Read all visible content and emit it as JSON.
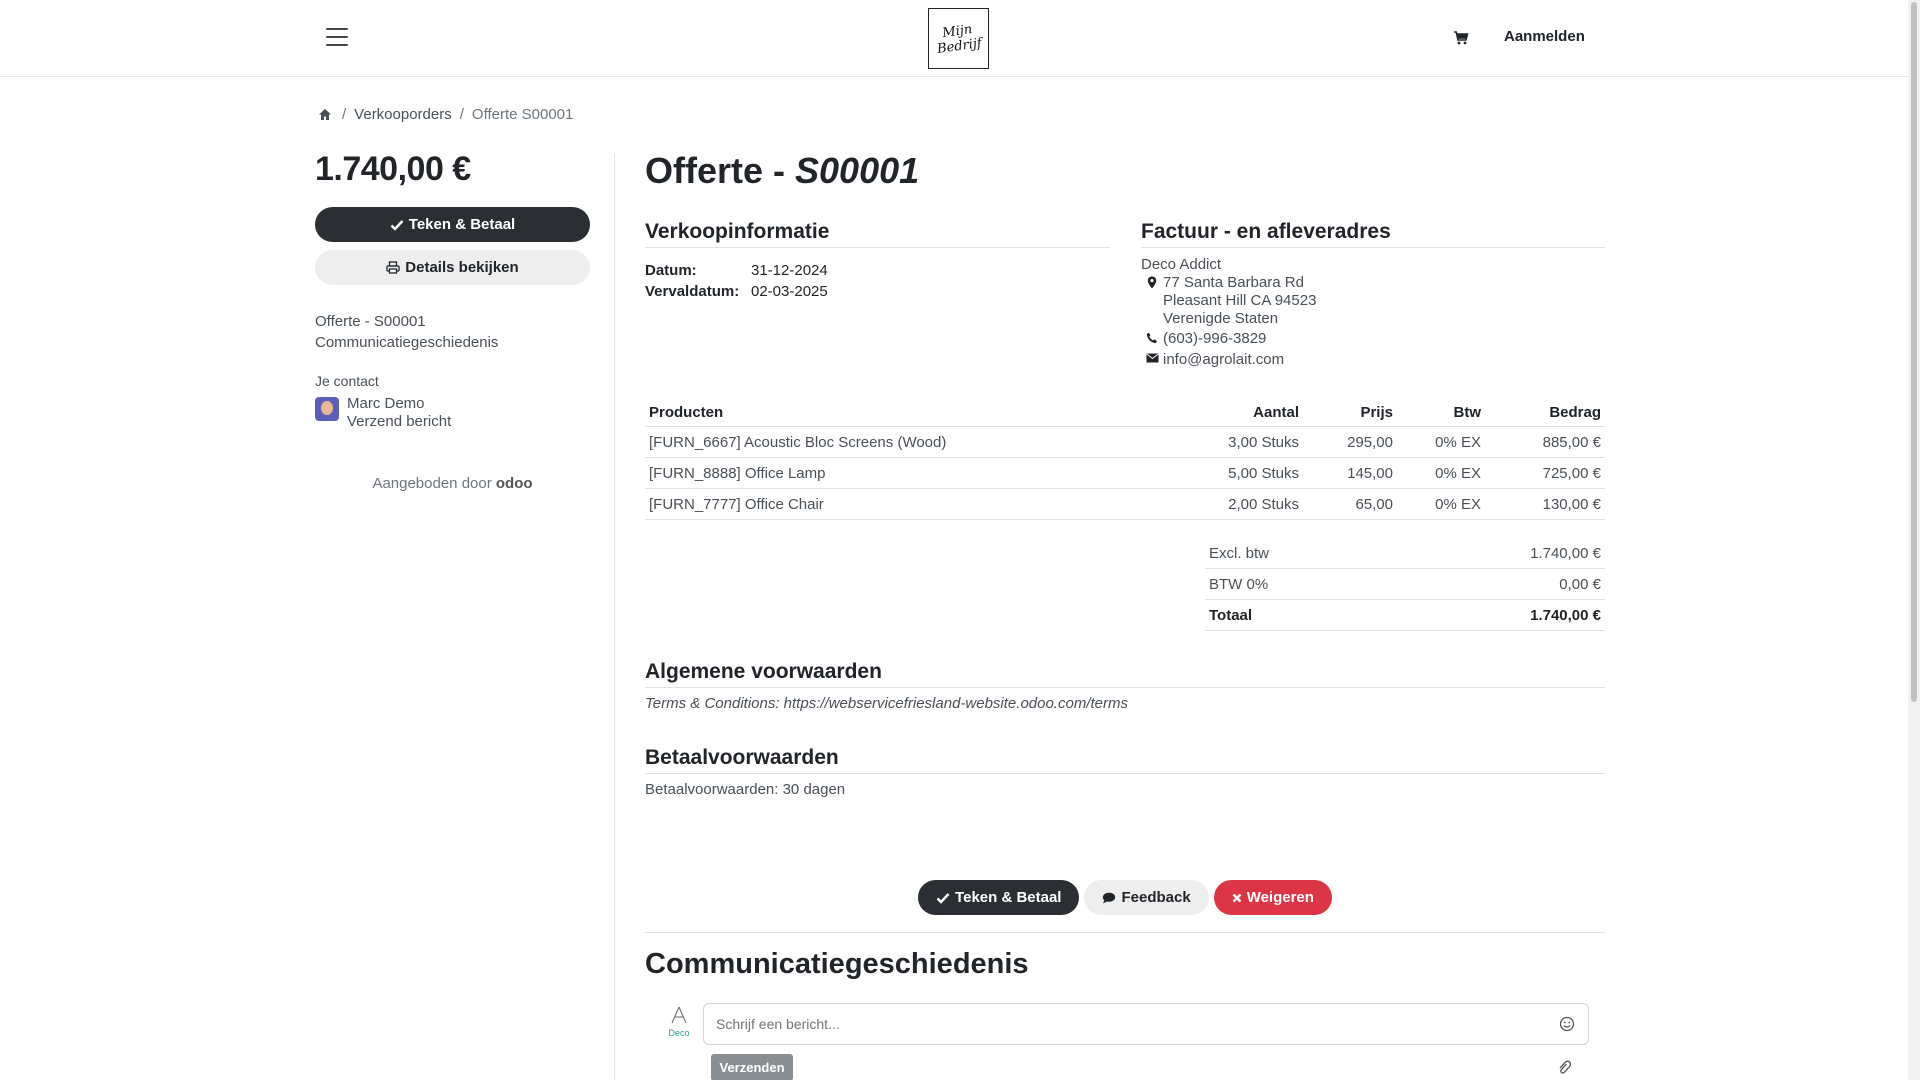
{
  "header": {
    "logo_line1": "Mijn",
    "logo_line2": "Bedrijf",
    "login_label": "Aanmelden"
  },
  "breadcrumb": {
    "items": [
      "Verkooporders",
      "Offerte S00001"
    ]
  },
  "sidebar": {
    "amount": "1.740,00 €",
    "sign_pay_label": "Teken & Betaal",
    "details_label": "Details bekijken",
    "link_quote": "Offerte - S00001",
    "link_history": "Communicatiegeschiedenis",
    "contact_label": "Je contact",
    "contact_name": "Marc Demo",
    "contact_action": "Verzend bericht",
    "powered_by": "Aangeboden door",
    "powered_brand": "odoo"
  },
  "main": {
    "title_prefix": "Offerte - ",
    "title_number": "S00001",
    "sales_info_heading": "Verkoopinformatie",
    "date_label": "Datum:",
    "date_value": "31-12-2024",
    "expiry_label": "Vervaldatum:",
    "expiry_value": "02-03-2025",
    "address_heading": "Factuur - en afleveradres",
    "customer_name": "Deco Addict",
    "address_line1": "77 Santa Barbara Rd",
    "address_line2": "Pleasant Hill CA 94523",
    "address_line3": "Verenigde Staten",
    "phone": "(603)-996-3829",
    "email": "info@agrolait.com"
  },
  "order_table": {
    "headers": {
      "product": "Producten",
      "qty": "Aantal",
      "price": "Prijs",
      "tax": "Btw",
      "amount": "Bedrag"
    },
    "rows": [
      {
        "product": "[FURN_6667] Acoustic Bloc Screens (Wood)",
        "qty": "3,00 Stuks",
        "price": "295,00",
        "tax": "0% EX",
        "amount": "885,00 €"
      },
      {
        "product": "[FURN_8888] Office Lamp",
        "qty": "5,00 Stuks",
        "price": "145,00",
        "tax": "0% EX",
        "amount": "725,00 €"
      },
      {
        "product": "[FURN_7777] Office Chair",
        "qty": "2,00 Stuks",
        "price": "65,00",
        "tax": "0% EX",
        "amount": "130,00 €"
      }
    ]
  },
  "totals": {
    "untaxed_label": "Excl. btw",
    "untaxed_value": "1.740,00 €",
    "tax_label": "BTW 0%",
    "tax_value": "0,00 €",
    "total_label": "Totaal",
    "total_value": "1.740,00 €"
  },
  "terms": {
    "heading": "Algemene voorwaarden",
    "text": "Terms & Conditions: https://webservicefriesland-website.odoo.com/terms"
  },
  "payment_terms": {
    "heading": "Betaalvoorwaarden",
    "text": "Betaalvoorwaarden: 30 dagen"
  },
  "actions": {
    "sign_pay_label": "Teken & Betaal",
    "feedback_label": "Feedback",
    "reject_label": "Weigeren"
  },
  "chatter": {
    "heading": "Communicatiegeschiedenis",
    "author_brand": "Deco",
    "input_placeholder": "Schrijf een bericht...",
    "send_label": "Verzenden"
  },
  "colors": {
    "primary_dark": "#2b2e33",
    "danger": "#dc3545",
    "light": "#eeeeee"
  }
}
